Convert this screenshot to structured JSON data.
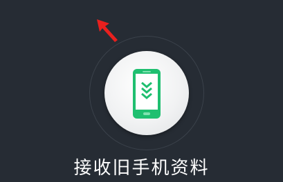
{
  "main": {
    "caption": "接收旧手机资料"
  },
  "icons": {
    "primary": "phone-download-icon",
    "annotation": "red-arrow-icon"
  },
  "colors": {
    "background": "#262c34",
    "accent_green": "#1fbf70",
    "arrow_red": "#e8201e"
  }
}
